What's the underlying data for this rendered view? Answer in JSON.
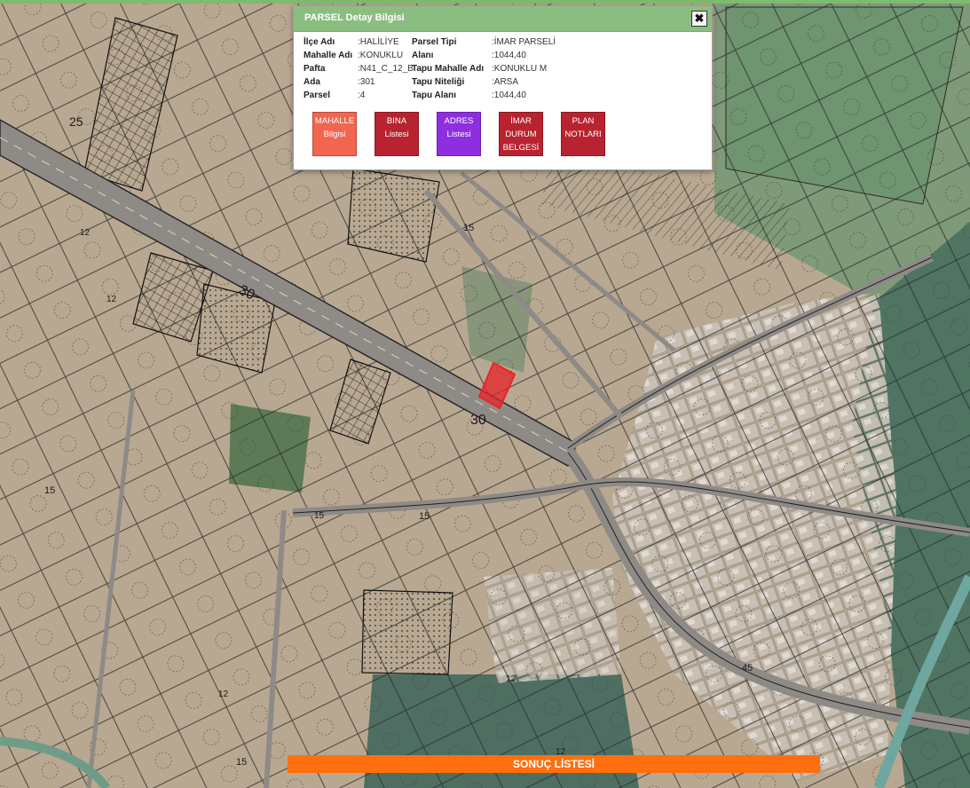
{
  "popup": {
    "title": "PARSEL Detay Bilgisi",
    "close_glyph": "✖",
    "rows": [
      {
        "l1": "İlçe Adı",
        "v1": ":HALİLİYE",
        "l2": "Parsel Tipi",
        "v2": ":İMAR PARSELİ"
      },
      {
        "l1": "Mahalle Adı",
        "v1": ":KONUKLU",
        "l2": "Alanı",
        "v2": ":1044,40"
      },
      {
        "l1": "Pafta",
        "v1": ":N41_C_12_B",
        "l2": "Tapu Mahalle Adı",
        "v2": ":KONUKLU M"
      },
      {
        "l1": "Ada",
        "v1": ":301",
        "l2": "Tapu Niteliği",
        "v2": ":ARSA"
      },
      {
        "l1": "Parsel",
        "v1": ":4",
        "l2": "Tapu Alanı",
        "v2": ":1044,40"
      }
    ],
    "buttons": [
      {
        "line1": "MAHALLE",
        "line2": "Bilgisi",
        "line3": "",
        "color": "#f2654f"
      },
      {
        "line1": "BINA",
        "line2": "Listesi",
        "line3": "",
        "color": "#b8232f"
      },
      {
        "line1": "ADRES",
        "line2": "Listesi",
        "line3": "",
        "color": "#8e2ee0"
      },
      {
        "line1": "İMAR",
        "line2": "DURUM",
        "line3": "BELGESİ",
        "color": "#b8232f"
      },
      {
        "line1": "PLAN",
        "line2": "NOTLARI",
        "line3": "",
        "color": "#b8232f"
      }
    ]
  },
  "result_bar": {
    "label": "SONUÇ LİSTESİ",
    "color": "#ff6f0e"
  },
  "map": {
    "road_labels": [
      "30",
      "30",
      "15",
      "15",
      "15",
      "15",
      "45",
      "12",
      "12",
      "12",
      "12",
      "12",
      "15",
      "25"
    ],
    "selected_parcel_color": "#e8232b",
    "colors": {
      "terrain": "#b9a891",
      "road": "#8e8a86",
      "field": "#557a5a",
      "lines": "#1c1c1c"
    }
  }
}
